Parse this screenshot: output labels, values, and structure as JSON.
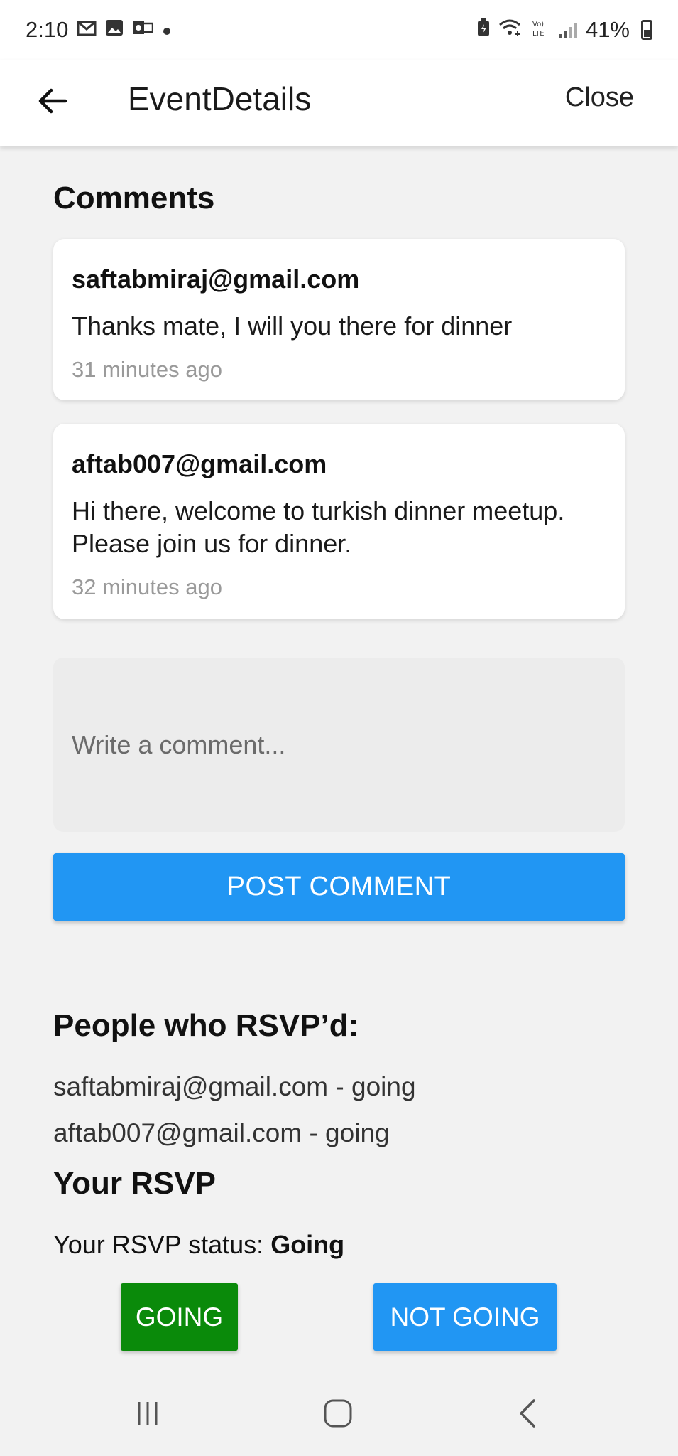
{
  "status_bar": {
    "time": "2:10",
    "notification_icons": [
      "gmail-icon",
      "gallery-icon",
      "outlook-icon",
      "dot-icon"
    ],
    "battery": "41%"
  },
  "app_bar": {
    "title": "EventDetails",
    "close_label": "Close"
  },
  "comments": {
    "heading": "Comments",
    "items": [
      {
        "user": "saftabmiraj@gmail.com",
        "text": "Thanks mate, I will you there for dinner",
        "time": "31 minutes ago"
      },
      {
        "user": "aftab007@gmail.com",
        "text": "Hi there, welcome to turkish dinner meetup. Please join us for dinner.",
        "time": "32 minutes ago"
      }
    ],
    "input_placeholder": "Write a comment...",
    "post_label": "POST COMMENT"
  },
  "rsvps": {
    "heading": "People who RSVP’d:",
    "entries": [
      "saftabmiraj@gmail.com - going",
      "aftab007@gmail.com - going"
    ]
  },
  "your_rsvp": {
    "heading": "Your RSVP",
    "status_label": "Your RSVP status: ",
    "status_value": "Going",
    "going_label": "GOING",
    "not_going_label": "NOT GOING"
  },
  "colors": {
    "primary": "#2196f3",
    "going": "#0a8a0a",
    "background": "#f2f2f2"
  }
}
